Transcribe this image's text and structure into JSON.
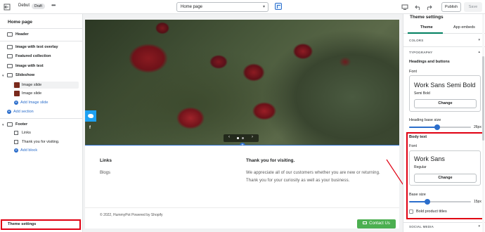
{
  "topbar": {
    "theme_name": "Debut",
    "status_badge": "Draft",
    "more_label": "•••",
    "page_select": "Home page",
    "publish_label": "Publish",
    "save_label": "Save"
  },
  "sidebar": {
    "title": "Home page",
    "header_label": "Header",
    "sections": [
      {
        "label": "Image with text overlay"
      },
      {
        "label": "Featured collection"
      },
      {
        "label": "Image with text"
      }
    ],
    "slideshow_label": "Slideshow",
    "slides": [
      {
        "label": "Image slide"
      },
      {
        "label": "Image slide"
      }
    ],
    "add_image_slide": "Add Image slide",
    "add_section": "Add section",
    "footer_label": "Footer",
    "footer_blocks": [
      {
        "label": "Links"
      },
      {
        "label": "Thank you for visiting."
      }
    ],
    "add_block": "Add block",
    "theme_settings": "Theme settings"
  },
  "preview": {
    "social_fb": "f",
    "footer": {
      "links_heading": "Links",
      "blogs_link": "Blogs",
      "thanks_heading": "Thank you for visiting.",
      "thanks_message": "We appreciate all of our customers whether you are new or returning. Thank you for your curiosity as well as your business.",
      "copyright": "© 2022, HummyPot Powered by Shopify",
      "contact_button": "Contact Us"
    }
  },
  "right_panel": {
    "title": "Theme settings",
    "tabs": [
      {
        "label": "Theme",
        "active": true
      },
      {
        "label": "App embeds",
        "active": false
      }
    ],
    "colors_label": "COLORS",
    "typography_label": "TYPOGRAPHY",
    "headings_title": "Headings and buttons",
    "headings_font_label": "Font",
    "headings_font_name": "Work Sans Semi Bold",
    "headings_font_style": "Semi Bold",
    "change_label": "Change",
    "heading_size_label": "Heading base size",
    "heading_size_value": "26px",
    "heading_size_fraction": 0.45,
    "body_title": "Body text",
    "body_font_label": "Font",
    "body_font_name": "Work Sans",
    "body_font_style": "Regular",
    "base_size_label": "Base size",
    "base_size_value": "15px",
    "base_size_fraction": 0.3,
    "bold_titles_label": "Bold product titles",
    "social_media_label": "SOCIAL MEDIA"
  },
  "colors": {
    "accent_blue": "#2c6ecb",
    "annotation_red": "#e00012",
    "contact_green": "#4caf50",
    "tab_underline": "#008060"
  }
}
